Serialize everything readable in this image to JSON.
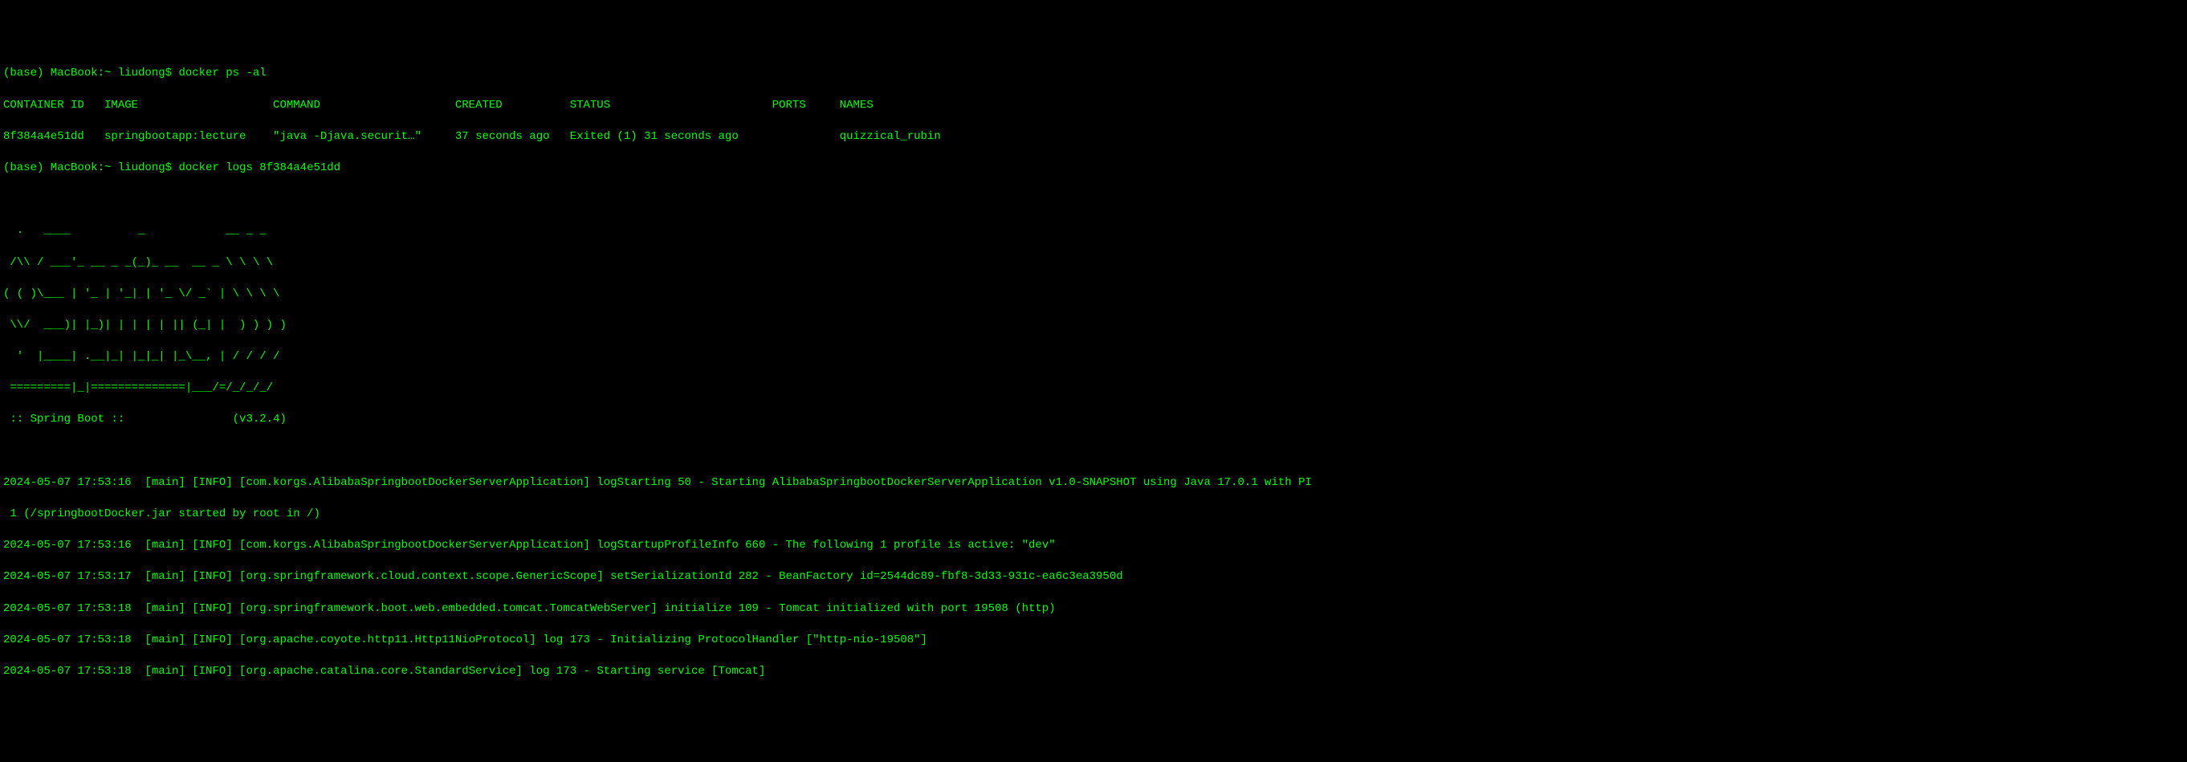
{
  "prompt1": {
    "prefix": "(base) MacBook:~ liudong$ ",
    "command": "docker ps -al"
  },
  "table": {
    "headers": {
      "container_id": "CONTAINER ID",
      "image": "IMAGE",
      "command": "COMMAND",
      "created": "CREATED",
      "status": "STATUS",
      "ports": "PORTS",
      "names": "NAMES"
    },
    "row": {
      "container_id": "8f384a4e51dd",
      "image": "springbootapp:lecture",
      "command": "\"java -Djava.securit…\"",
      "created": "37 seconds ago",
      "status": "Exited (1) 31 seconds ago",
      "ports": "",
      "names": "quizzical_rubin"
    }
  },
  "prompt2": {
    "prefix": "(base) MacBook:~ liudong$ ",
    "command": "docker logs 8f384a4e51dd"
  },
  "banner": {
    "line1": "  .   ____          _            __ _ _",
    "line2": " /\\\\ / ___'_ __ _ _(_)_ __  __ _ \\ \\ \\ \\",
    "line3": "( ( )\\___ | '_ | '_| | '_ \\/ _` | \\ \\ \\ \\",
    "line4": " \\\\/  ___)| |_)| | | | | || (_| |  ) ) ) )",
    "line5": "  '  |____| .__|_| |_|_| |_\\__, | / / / /",
    "line6": " =========|_|==============|___/=/_/_/_/",
    "spring_label": " :: Spring Boot ::",
    "version": "(v3.2.4)"
  },
  "logs": {
    "line1": "2024-05-07 17:53:16  [main] [INFO] [com.korgs.AlibabaSpringbootDockerServerApplication] logStarting 50 - Starting AlibabaSpringbootDockerServerApplication v1.0-SNAPSHOT using Java 17.0.1 with PI",
    "line2": " 1 (/springbootDocker.jar started by root in /)",
    "line3": "2024-05-07 17:53:16  [main] [INFO] [com.korgs.AlibabaSpringbootDockerServerApplication] logStartupProfileInfo 660 - The following 1 profile is active: \"dev\"",
    "line4": "2024-05-07 17:53:17  [main] [INFO] [org.springframework.cloud.context.scope.GenericScope] setSerializationId 282 - BeanFactory id=2544dc89-fbf8-3d33-931c-ea6c3ea3950d",
    "line5": "2024-05-07 17:53:18  [main] [INFO] [org.springframework.boot.web.embedded.tomcat.TomcatWebServer] initialize 109 - Tomcat initialized with port 19508 (http)",
    "line6": "2024-05-07 17:53:18  [main] [INFO] [org.apache.coyote.http11.Http11NioProtocol] log 173 - Initializing ProtocolHandler [\"http-nio-19508\"]",
    "line7": "2024-05-07 17:53:18  [main] [INFO] [org.apache.catalina.core.StandardService] log 173 - Starting service [Tomcat]"
  }
}
